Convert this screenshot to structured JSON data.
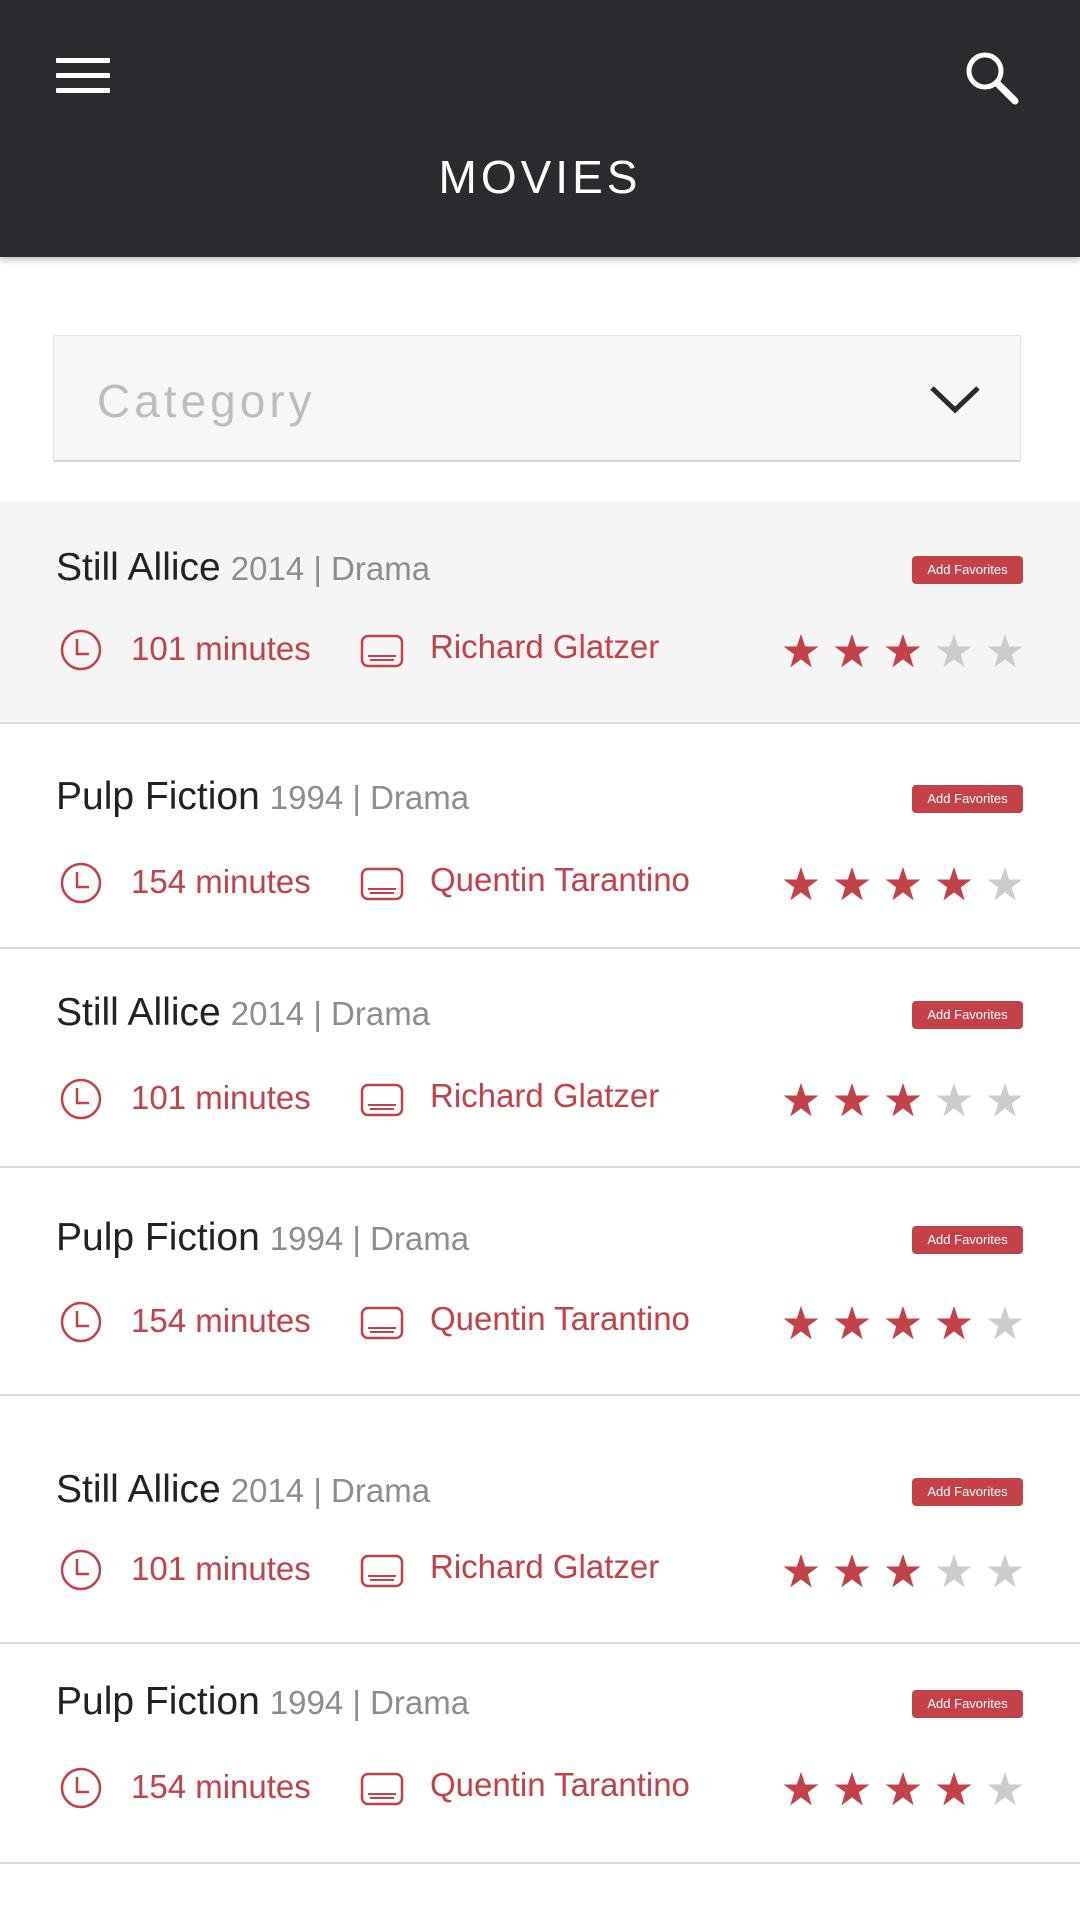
{
  "header": {
    "title": "MOVIES",
    "menu_icon": "hamburger-menu-icon",
    "search_icon": "search-icon",
    "background": "#2a2b2f"
  },
  "category": {
    "placeholder": "Category",
    "icon": "chevron-down-icon"
  },
  "colors": {
    "accent": "#c4414a",
    "star_on": "#c4414a",
    "star_off": "#cccccc"
  },
  "movies": [
    {
      "title": "Still Allice",
      "meta": "2014 | Drama",
      "fav_label": "Add Favorites",
      "duration": "101 minutes",
      "director": "Richard Glatzer",
      "rating": 3,
      "rating_max": 5,
      "highlighted": true
    },
    {
      "title": "Pulp Fiction",
      "meta": "1994 | Drama",
      "fav_label": "Add Favorites",
      "duration": "154 minutes",
      "director": "Quentin Tarantino",
      "rating": 4,
      "rating_max": 5,
      "highlighted": false
    },
    {
      "title": "Still Allice",
      "meta": "2014 | Drama",
      "fav_label": "Add Favorites",
      "duration": "101 minutes",
      "director": "Richard Glatzer",
      "rating": 3,
      "rating_max": 5,
      "highlighted": false
    },
    {
      "title": "Pulp Fiction",
      "meta": "1994 | Drama",
      "fav_label": "Add Favorites",
      "duration": "154 minutes",
      "director": "Quentin Tarantino",
      "rating": 4,
      "rating_max": 5,
      "highlighted": false
    },
    {
      "title": "Still Allice",
      "meta": "2014 | Drama",
      "fav_label": "Add Favorites",
      "duration": "101 minutes",
      "director": "Richard Glatzer",
      "rating": 3,
      "rating_max": 5,
      "highlighted": false
    },
    {
      "title": "Pulp Fiction",
      "meta": "1994 | Drama",
      "fav_label": "Add Favorites",
      "duration": "154 minutes",
      "director": "Quentin Tarantino",
      "rating": 4,
      "rating_max": 5,
      "highlighted": false
    }
  ]
}
